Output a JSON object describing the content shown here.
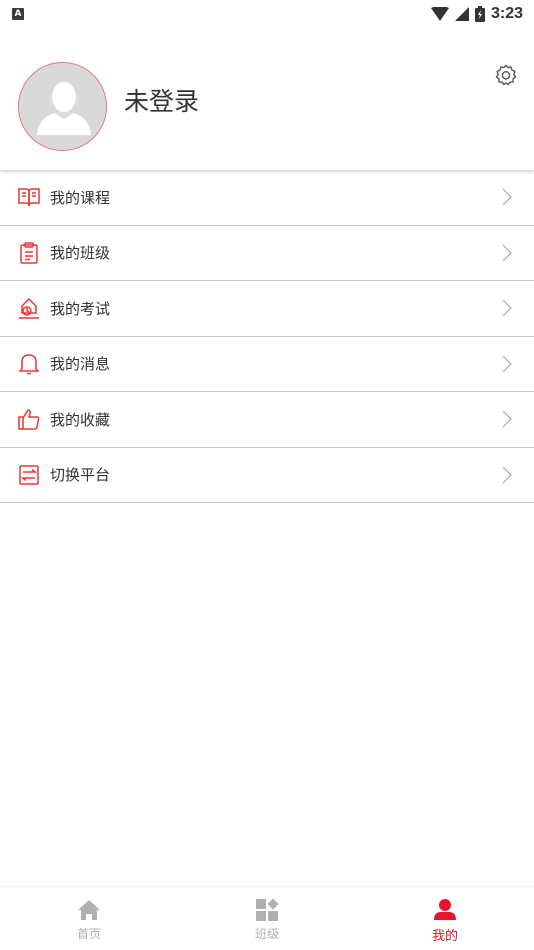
{
  "status_bar": {
    "notification_icon": "A",
    "time": "3:23"
  },
  "profile": {
    "username": "未登录"
  },
  "menu": {
    "items": [
      {
        "label": "我的课程",
        "icon": "book-icon"
      },
      {
        "label": "我的班级",
        "icon": "clipboard-icon"
      },
      {
        "label": "我的考试",
        "icon": "exam-icon"
      },
      {
        "label": "我的消息",
        "icon": "bell-icon"
      },
      {
        "label": "我的收藏",
        "icon": "thumbs-up-icon"
      },
      {
        "label": "切换平台",
        "icon": "switch-icon"
      }
    ]
  },
  "bottom_nav": {
    "items": [
      {
        "label": "首页",
        "icon": "home-icon",
        "active": false
      },
      {
        "label": "班级",
        "icon": "grid-icon",
        "active": false
      },
      {
        "label": "我的",
        "icon": "user-icon",
        "active": true
      }
    ]
  },
  "colors": {
    "accent": "#e8142d",
    "icon_red": "#e53935",
    "inactive": "#b0b0b0",
    "divider": "#c8c8c8"
  }
}
